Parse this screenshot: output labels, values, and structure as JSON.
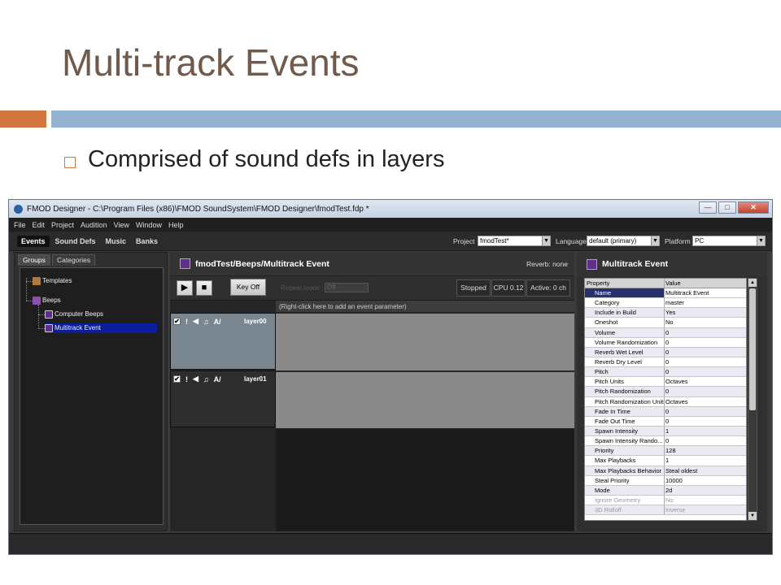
{
  "slide": {
    "title": "Multi-track Events",
    "bullet": "Comprised of sound defs in layers"
  },
  "colors": {
    "accent_orange": "#d2763f",
    "accent_blue": "#93b3d0",
    "title": "#6f5a4b"
  },
  "app": {
    "window_title": "FMOD Designer - C:\\Program Files (x86)\\FMOD SoundSystem\\FMOD Designer\\fmodTest.fdp *",
    "window_buttons": {
      "minimize": "—",
      "maximize": "□",
      "close": "✕"
    },
    "menu": [
      "File",
      "Edit",
      "Project",
      "Audition",
      "View",
      "Window",
      "Help"
    ],
    "tool_tabs": [
      "Events",
      "Sound Defs",
      "Music",
      "Banks"
    ],
    "project": {
      "label": "Project",
      "value": "fmodTest*"
    },
    "language": {
      "label": "Language",
      "value": "default (primary)"
    },
    "platform": {
      "label": "Platform",
      "value": "PC"
    },
    "dropdown_glyph": "▼",
    "panel_tabs": [
      "Groups",
      "Categories"
    ],
    "tree": {
      "templates": "Templates",
      "beeps": "Beeps",
      "computer_beeps": "Computer Beeps",
      "multitrack_event": "Multitrack Event"
    },
    "event": {
      "title": "fmodTest/Beeps/Multitrack Event",
      "reverb": "Reverb: none",
      "play_glyph": "▶",
      "stop_glyph": "■",
      "key_off": "Key Off",
      "repeat_mode_label": "Repeat mode :",
      "repeat_mode_value": "Off",
      "status": "Stopped",
      "cpu": "CPU 0.12",
      "active": "Active: 0 ch",
      "parameter_hint": "(Right-click here to add an event parameter)",
      "layers": [
        {
          "name": "layer00",
          "check": "✔"
        },
        {
          "name": "layer01",
          "check": "✔"
        }
      ],
      "layer_icons": {
        "exclaim": "!",
        "speaker": "◀",
        "note": "♫",
        "fx": "A/"
      }
    },
    "properties": {
      "title": "Multitrack Event",
      "col_property": "Property",
      "col_value": "Value",
      "rows": [
        {
          "p": "Name",
          "v": "Multitrack Event"
        },
        {
          "p": "Category",
          "v": "master"
        },
        {
          "p": "Include in Build",
          "v": "Yes"
        },
        {
          "p": "Oneshot",
          "v": "No"
        },
        {
          "p": "Volume",
          "v": "0"
        },
        {
          "p": "Volume Randomization",
          "v": "0"
        },
        {
          "p": "Reverb Wet Level",
          "v": "0"
        },
        {
          "p": "Reverb Dry Level",
          "v": "0"
        },
        {
          "p": "Pitch",
          "v": "0"
        },
        {
          "p": "Pitch Units",
          "v": "Octaves"
        },
        {
          "p": "Pitch Randomization",
          "v": "0"
        },
        {
          "p": "Pitch Randomization Units",
          "v": "Octaves"
        },
        {
          "p": "Fade In Time",
          "v": "0"
        },
        {
          "p": "Fade Out Time",
          "v": "0"
        },
        {
          "p": "Spawn Intensity",
          "v": "1"
        },
        {
          "p": "Spawn Intensity Rando...",
          "v": "0"
        },
        {
          "p": "Priority",
          "v": "128"
        },
        {
          "p": "Max Playbacks",
          "v": "1"
        },
        {
          "p": "Max Playbacks Behavior",
          "v": "Steal oldest"
        },
        {
          "p": "Steal Priority",
          "v": "10000"
        },
        {
          "p": "Mode",
          "v": "2d"
        },
        {
          "p": "Ignore Geometry",
          "v": "No"
        },
        {
          "p": "3D Rolloff",
          "v": "Inverse"
        }
      ],
      "scroll_up": "▲",
      "scroll_down": "▼"
    }
  }
}
